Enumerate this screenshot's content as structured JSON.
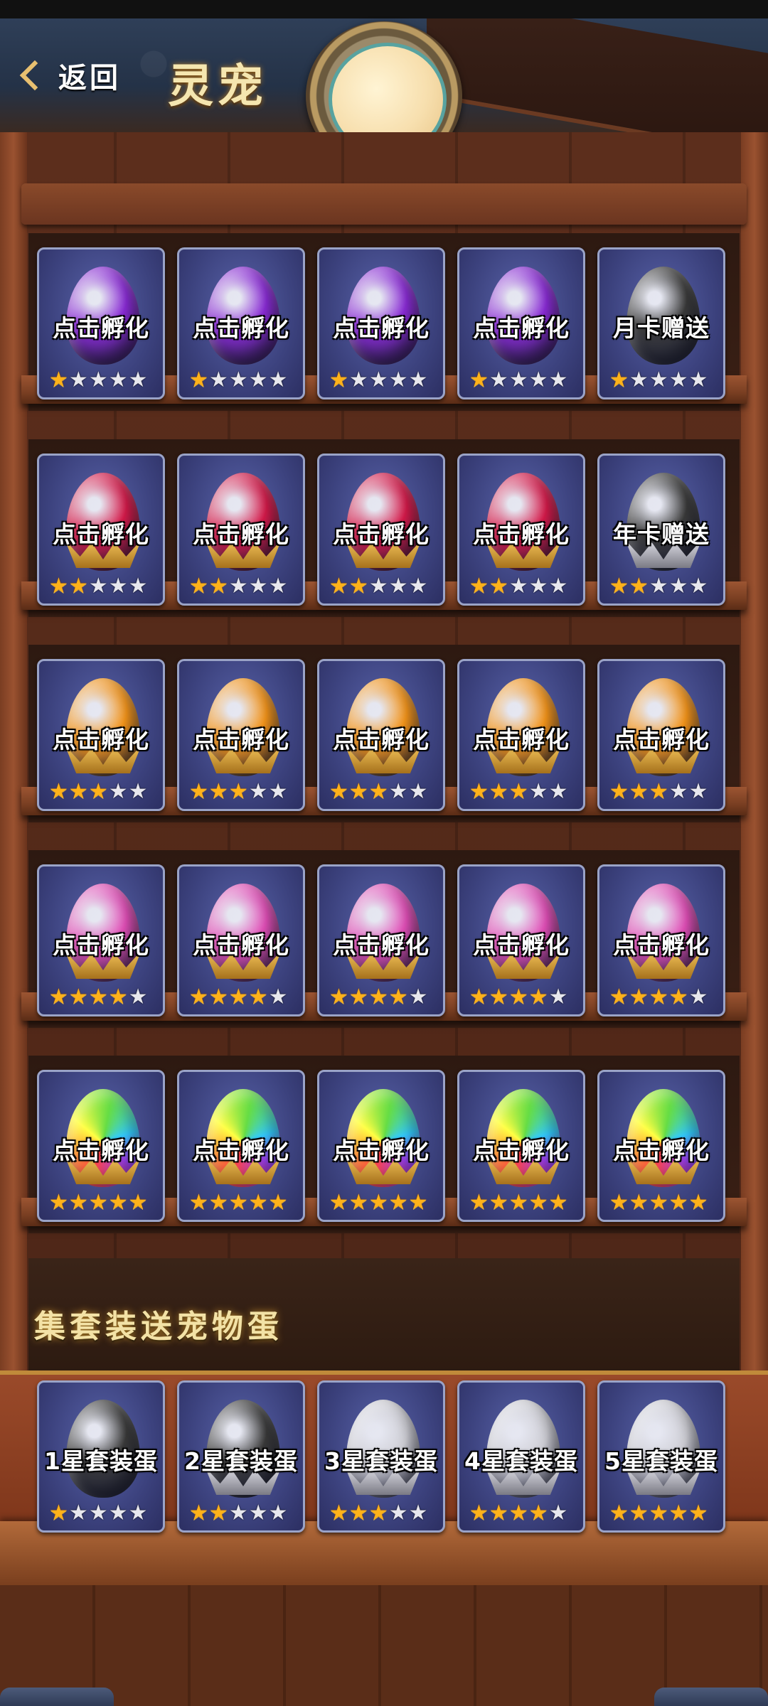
{
  "header": {
    "back_label": "返回",
    "title": "灵宠"
  },
  "colors": {
    "purple": "#8a2bd6",
    "red": "#d61a4a",
    "orange": "#f5951a",
    "pink": "#e24fb8",
    "rainbow": "#9ad04a",
    "dark": "#3a3a3a",
    "silver": "#cfcfd6",
    "star_on": "#ffb21a",
    "star_off": "#e7e7ee"
  },
  "shelves": [
    {
      "stars": 1,
      "items": [
        {
          "label": "点击孵化",
          "color": "purple"
        },
        {
          "label": "点击孵化",
          "color": "purple"
        },
        {
          "label": "点击孵化",
          "color": "purple"
        },
        {
          "label": "点击孵化",
          "color": "purple"
        },
        {
          "label": "月卡赠送",
          "color": "dark"
        }
      ]
    },
    {
      "stars": 2,
      "items": [
        {
          "label": "点击孵化",
          "color": "red"
        },
        {
          "label": "点击孵化",
          "color": "red"
        },
        {
          "label": "点击孵化",
          "color": "red"
        },
        {
          "label": "点击孵化",
          "color": "red"
        },
        {
          "label": "年卡赠送",
          "color": "dark"
        }
      ]
    },
    {
      "stars": 3,
      "items": [
        {
          "label": "点击孵化",
          "color": "orange"
        },
        {
          "label": "点击孵化",
          "color": "orange"
        },
        {
          "label": "点击孵化",
          "color": "orange"
        },
        {
          "label": "点击孵化",
          "color": "orange"
        },
        {
          "label": "点击孵化",
          "color": "orange"
        }
      ]
    },
    {
      "stars": 4,
      "items": [
        {
          "label": "点击孵化",
          "color": "pink"
        },
        {
          "label": "点击孵化",
          "color": "pink"
        },
        {
          "label": "点击孵化",
          "color": "pink"
        },
        {
          "label": "点击孵化",
          "color": "pink"
        },
        {
          "label": "点击孵化",
          "color": "pink"
        }
      ]
    },
    {
      "stars": 5,
      "items": [
        {
          "label": "点击孵化",
          "color": "rainbow"
        },
        {
          "label": "点击孵化",
          "color": "rainbow"
        },
        {
          "label": "点击孵化",
          "color": "rainbow"
        },
        {
          "label": "点击孵化",
          "color": "rainbow"
        },
        {
          "label": "点击孵化",
          "color": "rainbow"
        }
      ]
    }
  ],
  "bonus": {
    "title": "集套装送宠物蛋",
    "items": [
      {
        "label": "1星套装蛋",
        "stars": 1,
        "color": "dark"
      },
      {
        "label": "2星套装蛋",
        "stars": 2,
        "color": "dark"
      },
      {
        "label": "3星套装蛋",
        "stars": 3,
        "color": "silver"
      },
      {
        "label": "4星套装蛋",
        "stars": 4,
        "color": "silver"
      },
      {
        "label": "5星套装蛋",
        "stars": 5,
        "color": "silver"
      }
    ]
  },
  "max_stars": 5
}
